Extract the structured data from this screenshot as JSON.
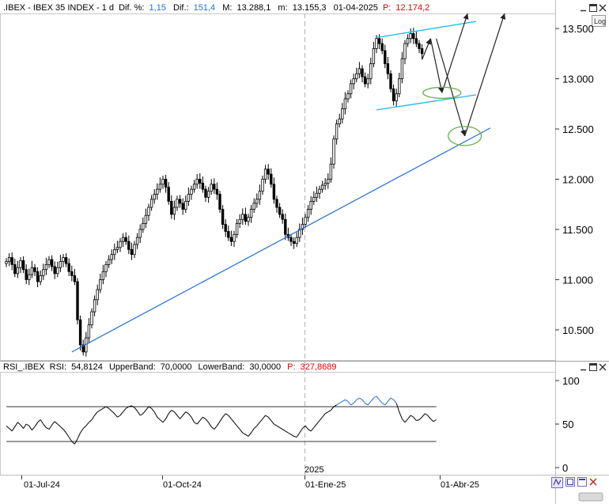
{
  "header": {
    "symbol": ".IBEX - IBEX 35 INDEX - 1 d",
    "dif_pct_label": "Dif. %:",
    "dif_pct_value": "1,15",
    "dif_label": "Dif.:",
    "dif_value": "151,4",
    "max_label": "M:",
    "max_value": "13.288,1",
    "min_label": "m:",
    "min_value": "13.155,3",
    "date": "01-04-2025",
    "p_label": "P:",
    "p_value": "12.174,2",
    "log_label": "Log"
  },
  "rsi_header": {
    "name": "RSI_.IBEX",
    "rsi_label": "RSI:",
    "rsi_value": "54,8124",
    "upper_label": "UpperBand:",
    "upper_value": "70,0000",
    "lower_label": "LowerBand:",
    "lower_value": "30,0000",
    "p_label": "P:",
    "p_value": "327,8689"
  },
  "xaxis": {
    "labels": [
      "01-Jul-24",
      "01-Oct-24",
      "01-Ene-25",
      "01-Abr-25"
    ],
    "year_marker": "2025"
  },
  "colors": {
    "header_value": "#1e6fd9",
    "header_p": "#e00000",
    "trendline": "#1e6fd9",
    "channel": "#19b8e8",
    "ellipse": "#6ab04c",
    "rsi_above": "#1e6fd9",
    "rsi_below": "#e00000"
  },
  "chart_data": [
    {
      "type": "candlestick",
      "ylim": [
        10200,
        13650
      ],
      "yticks": [
        "10.500",
        "11.000",
        "11.500",
        "12.000",
        "12.500",
        "13.000",
        "13.500"
      ],
      "ytick_values": [
        10500,
        11000,
        11500,
        12000,
        12500,
        13000,
        13500
      ],
      "closes": [
        11180,
        11220,
        11150,
        11060,
        11120,
        11190,
        11100,
        11000,
        11050,
        11120,
        11080,
        10980,
        11040,
        11100,
        11150,
        11200,
        11130,
        11060,
        11120,
        11180,
        11220,
        11160,
        11080,
        11040,
        10980,
        10600,
        10350,
        10280,
        10420,
        10550,
        10680,
        10800,
        10900,
        11000,
        11080,
        11150,
        11200,
        11250,
        11300,
        11320,
        11380,
        11420,
        11380,
        11300,
        11250,
        11350,
        11420,
        11500,
        11560,
        11640,
        11720,
        11800,
        11850,
        11900,
        11950,
        12000,
        11920,
        11780,
        11650,
        11720,
        11800,
        11760,
        11700,
        11780,
        11850,
        11900,
        11950,
        12000,
        11960,
        11900,
        11820,
        11880,
        11950,
        11900,
        11850,
        11700,
        11550,
        11480,
        11420,
        11380,
        11450,
        11560,
        11600,
        11650,
        11580,
        11620,
        11700,
        11760,
        11800,
        11880,
        12000,
        12100,
        12050,
        11950,
        11800,
        11720,
        11650,
        11600,
        11450,
        11420,
        11380,
        11360,
        11420,
        11500,
        11550,
        11620,
        11700,
        11780,
        11820,
        11860,
        11900,
        11940,
        11960,
        12000,
        12150,
        12400,
        12550,
        12600,
        12700,
        12800,
        12850,
        12950,
        13000,
        13050,
        13100,
        13020,
        12950,
        13000,
        13150,
        13300,
        13400,
        13350,
        13280,
        13150,
        13050,
        12900,
        12780,
        12850,
        13000,
        13200,
        13350,
        13400,
        13450,
        13400,
        13350,
        13300,
        13250
      ],
      "trendline": {
        "from": {
          "i": 23,
          "v": 10280
        },
        "to": {
          "i": 170,
          "v": 12510
        }
      },
      "channel_upper": {
        "from": {
          "i": 130,
          "v": 13410
        },
        "to": {
          "i": 165,
          "v": 13570
        }
      },
      "channel_lower": {
        "from": {
          "i": 130,
          "v": 12690
        },
        "to": {
          "i": 165,
          "v": 12840
        }
      },
      "projection_a": [
        {
          "i": 146,
          "v": 13190
        },
        {
          "i": 149,
          "v": 13400
        },
        {
          "i": 153,
          "v": 12860
        },
        {
          "i": 162,
          "v": 13650
        }
      ],
      "projection_b": [
        {
          "i": 151,
          "v": 13400
        },
        {
          "i": 161,
          "v": 12430
        },
        {
          "i": 175,
          "v": 13650
        }
      ],
      "ellipses": [
        {
          "i": 153,
          "v": 12860
        },
        {
          "i": 161,
          "v": 12430
        }
      ]
    },
    {
      "type": "line",
      "ylim": [
        0,
        100
      ],
      "yticks": [
        "0",
        "50",
        "100"
      ],
      "ytick_values": [
        0,
        50,
        100
      ],
      "bands": [
        70,
        30
      ],
      "values": [
        48,
        45,
        42,
        47,
        52,
        49,
        45,
        50,
        48,
        43,
        47,
        52,
        55,
        50,
        46,
        44,
        49,
        53,
        50,
        47,
        44,
        40,
        35,
        30,
        27,
        33,
        40,
        45,
        48,
        52,
        55,
        60,
        64,
        66,
        68,
        70,
        68,
        65,
        62,
        58,
        60,
        64,
        68,
        70,
        71,
        69,
        65,
        60,
        62,
        66,
        70,
        68,
        64,
        58,
        55,
        52,
        56,
        62,
        66,
        64,
        60,
        56,
        60,
        64,
        62,
        58,
        52,
        50,
        54,
        58,
        56,
        52,
        47,
        44,
        48,
        53,
        58,
        62,
        60,
        56,
        52,
        48,
        44,
        40,
        38,
        36,
        40,
        45,
        48,
        52,
        56,
        60,
        58,
        54,
        50,
        48,
        46,
        44,
        42,
        40,
        38,
        36,
        35,
        40,
        45,
        48,
        44,
        42,
        46,
        50,
        54,
        58,
        62,
        64,
        66,
        70,
        72,
        74,
        76,
        78,
        76,
        72,
        74,
        78,
        80,
        78,
        74,
        72,
        76,
        80,
        82,
        78,
        74,
        72,
        76,
        80,
        78,
        74,
        64,
        56,
        52,
        56,
        60,
        58,
        54,
        55,
        58,
        62,
        60,
        56,
        53,
        55
      ]
    }
  ]
}
